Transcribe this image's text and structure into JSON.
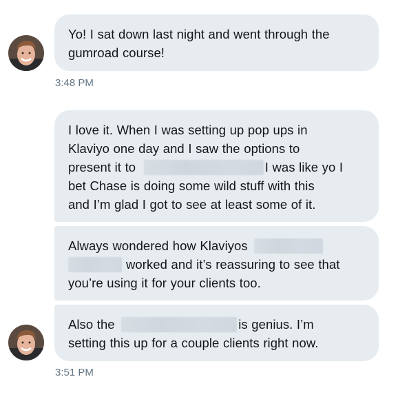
{
  "conversation": {
    "groups": [
      {
        "timestamp": "3:48 PM",
        "messages": [
          {
            "lines": [
              [
                "Yo! I sat down last night and went through the"
              ],
              [
                "gumroad course!"
              ]
            ]
          }
        ]
      },
      {
        "timestamp": "3:51 PM",
        "messages": [
          {
            "lines": [
              [
                "I love it. When I was setting up pop ups in"
              ],
              [
                "Klaviyo one day and I saw the options to"
              ],
              [
                "present it to",
                "",
                "I was like yo I"
              ],
              [
                "bet Chase is doing some wild stuff with this"
              ],
              [
                "and I’m glad I got to see at least some of it."
              ]
            ]
          },
          {
            "lines": [
              [
                "Always wondered how Klaviyos",
                ""
              ],
              [
                "",
                "worked and it’s reassuring to see that"
              ],
              [
                "you’re using it for your clients too."
              ]
            ]
          },
          {
            "lines": [
              [
                "Also the",
                "",
                "is genius. I’m"
              ],
              [
                "setting this up for a couple clients right now."
              ]
            ]
          }
        ]
      }
    ]
  },
  "colors": {
    "bubble_background": "#e6ecf0",
    "text": "#14171a",
    "timestamp": "#657786",
    "redaction": "#d2d9df"
  }
}
